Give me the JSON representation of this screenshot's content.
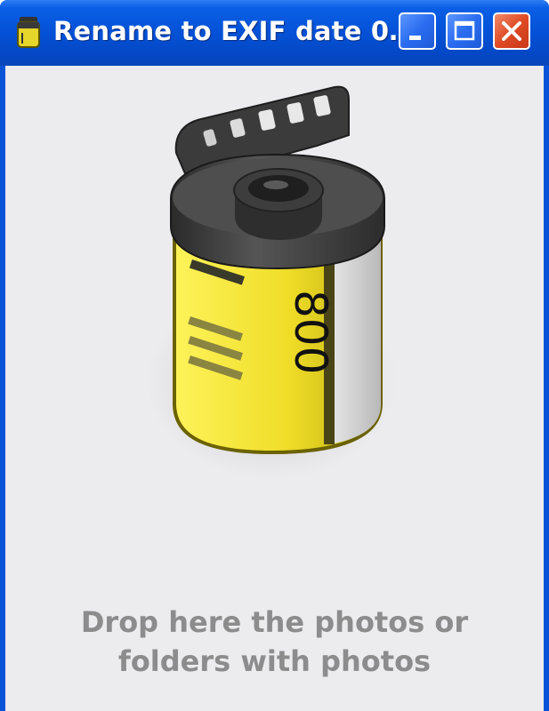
{
  "window": {
    "title": "Rename to EXIF date 0…",
    "controls": {
      "minimize": "minimize",
      "maximize": "maximize",
      "close": "close"
    }
  },
  "main": {
    "film_label": "800",
    "drop_text_line1": "Drop here the photos or",
    "drop_text_line2": "folders with photos"
  },
  "colors": {
    "titlebar": "#0553d9",
    "client_bg": "#ecebee",
    "film_yellow": "#f2e23a",
    "drop_text": "#8c8c8c"
  }
}
